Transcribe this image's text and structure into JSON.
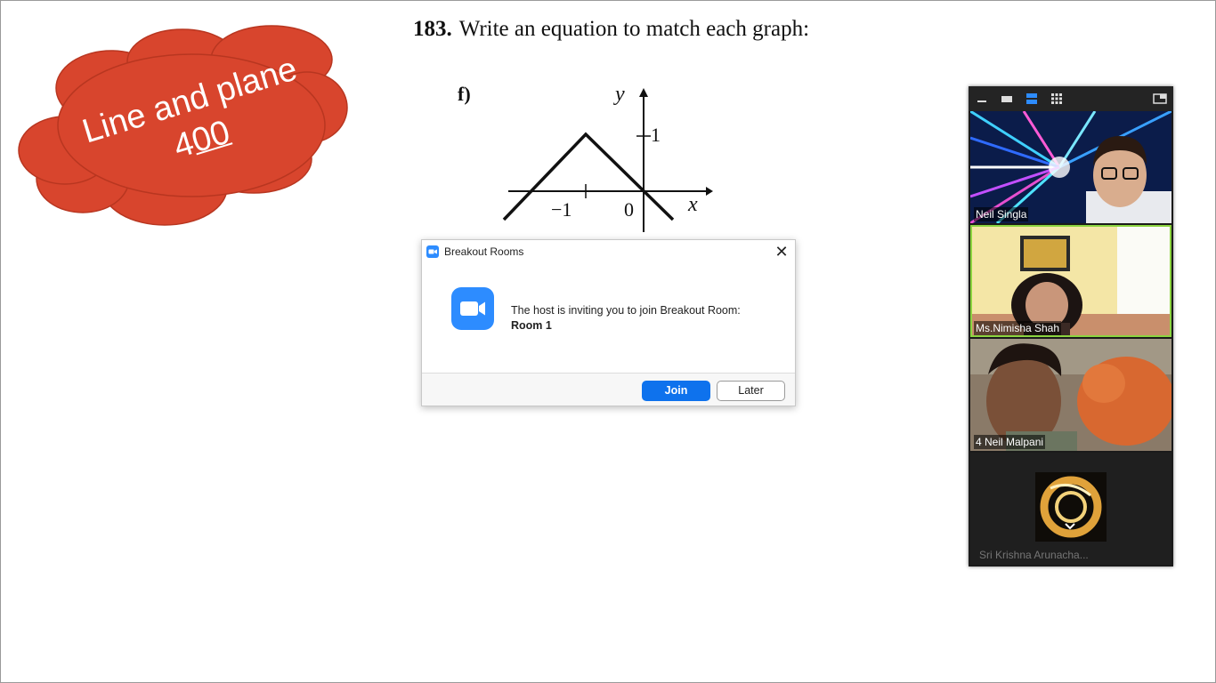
{
  "slide": {
    "problem_number": "183.",
    "prompt": "Write an equation to match each graph:",
    "part_label": "f)",
    "cloud_line1": "Line and plane",
    "cloud_number_a": "4",
    "cloud_number_b": "00",
    "cloud_color": "#d8452d",
    "graph": {
      "y_label": "y",
      "x_label": "x",
      "tick_y1": "1",
      "tick_xm1": "−1",
      "tick_0": "0"
    }
  },
  "dialog": {
    "title": "Breakout Rooms",
    "message": "The host is inviting you to join Breakout Room:",
    "room_name": "Room 1",
    "join_label": "Join",
    "later_label": "Later",
    "accent": "#0e72ed"
  },
  "gallery": {
    "participants": [
      {
        "name": "Neil Singla"
      },
      {
        "name": "Ms.Nimisha Shah"
      },
      {
        "name": "4 Neil  Malpani"
      },
      {
        "name": "Sri Krishna Arunacha..."
      }
    ]
  }
}
